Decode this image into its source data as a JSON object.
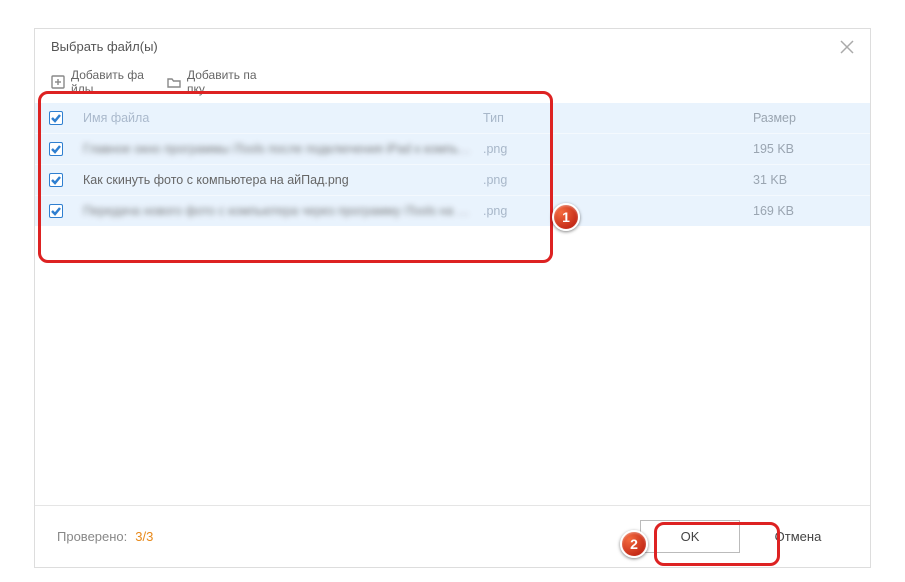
{
  "dialog": {
    "title": "Выбрать файл(ы)"
  },
  "toolbar": {
    "add_files": "Добавить фа йлы",
    "add_folder": "Добавить па пку"
  },
  "table": {
    "header": {
      "name": "Имя файла",
      "type": "Тип",
      "size": "Размер"
    },
    "rows": [
      {
        "checked": true,
        "name_blurred": true,
        "name": "Главное окно программы iTools после подключения iPad к компь…",
        "type": ".png",
        "size": "195 KB"
      },
      {
        "checked": true,
        "name_blurred": false,
        "name": "Как скинуть фото с компьютера на айПад.png",
        "type": ".png",
        "size": "31 KB"
      },
      {
        "checked": true,
        "name_blurred": true,
        "name": "Передача нового фото с компьютера через программу iTools на …",
        "type": ".png",
        "size": "169 KB"
      }
    ]
  },
  "footer": {
    "checked_label": "Проверено:",
    "count": "3/3",
    "ok": "OK",
    "cancel": "Отмена"
  },
  "callouts": {
    "one": "1",
    "two": "2"
  }
}
